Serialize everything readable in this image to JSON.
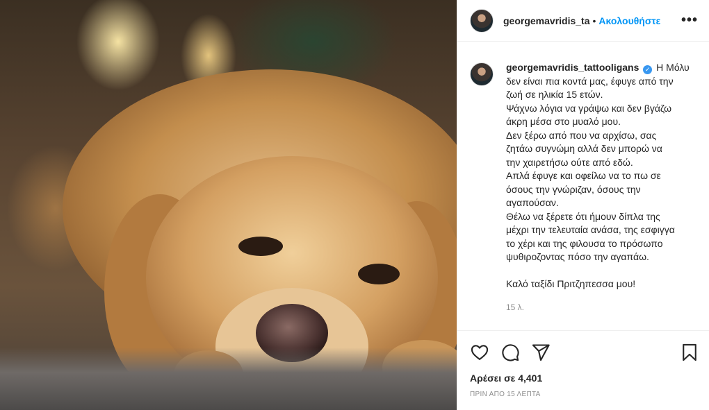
{
  "post": {
    "image_alt": "",
    "header": {
      "username": "georgemavridis_ta",
      "separator": "•",
      "follow_label": "Ακολουθήστε",
      "more_label": "•••"
    },
    "caption": {
      "username": "georgemavridis_tattooligans",
      "lines": [
        "Η Μόλυ",
        "δεν είναι πια κοντά μας, έφυγε από την",
        "ζωή σε ηλικία 15 ετών.",
        "Ψάχνω λόγια να γράψω και δεν βγάζω",
        "άκρη μέσα στο μυαλό μου.",
        "Δεν ξέρω από που να αρχίσω, σας",
        "ζητάω συγνώμη αλλά δεν μπορώ να",
        "την χαιρετήσω ούτε από εδώ.",
        "Απλά έφυγε και οφείλω να το πω σε",
        "όσους την γνώριζαν, όσους την",
        "αγαπούσαν.",
        "Θέλω να ξέρετε ότι ήμουν δίπλα της",
        "μέχρι την τελευταία ανάσα, της εσφιγγα",
        "το χέρι και της φιλουσα το πρόσωπο",
        "ψυθιροζοντας πόσο την αγαπάω.",
        "",
        "Καλό ταξίδι Πριτζηπεσσα μου!"
      ],
      "time_ago": "15 λ."
    },
    "likes": "Αρέσει σε 4,401",
    "posted_ago": "ΠΡΙΝ ΑΠΟ 15 ΛΕΠΤΑ"
  },
  "icons": {
    "like": "heart-icon",
    "comment": "comment-icon",
    "share": "share-icon",
    "save": "bookmark-icon",
    "verified": "verified-badge-icon"
  },
  "colors": {
    "accent": "#0095f6",
    "verified": "#3897f0",
    "text": "#262626",
    "muted": "#8e8e8e"
  }
}
